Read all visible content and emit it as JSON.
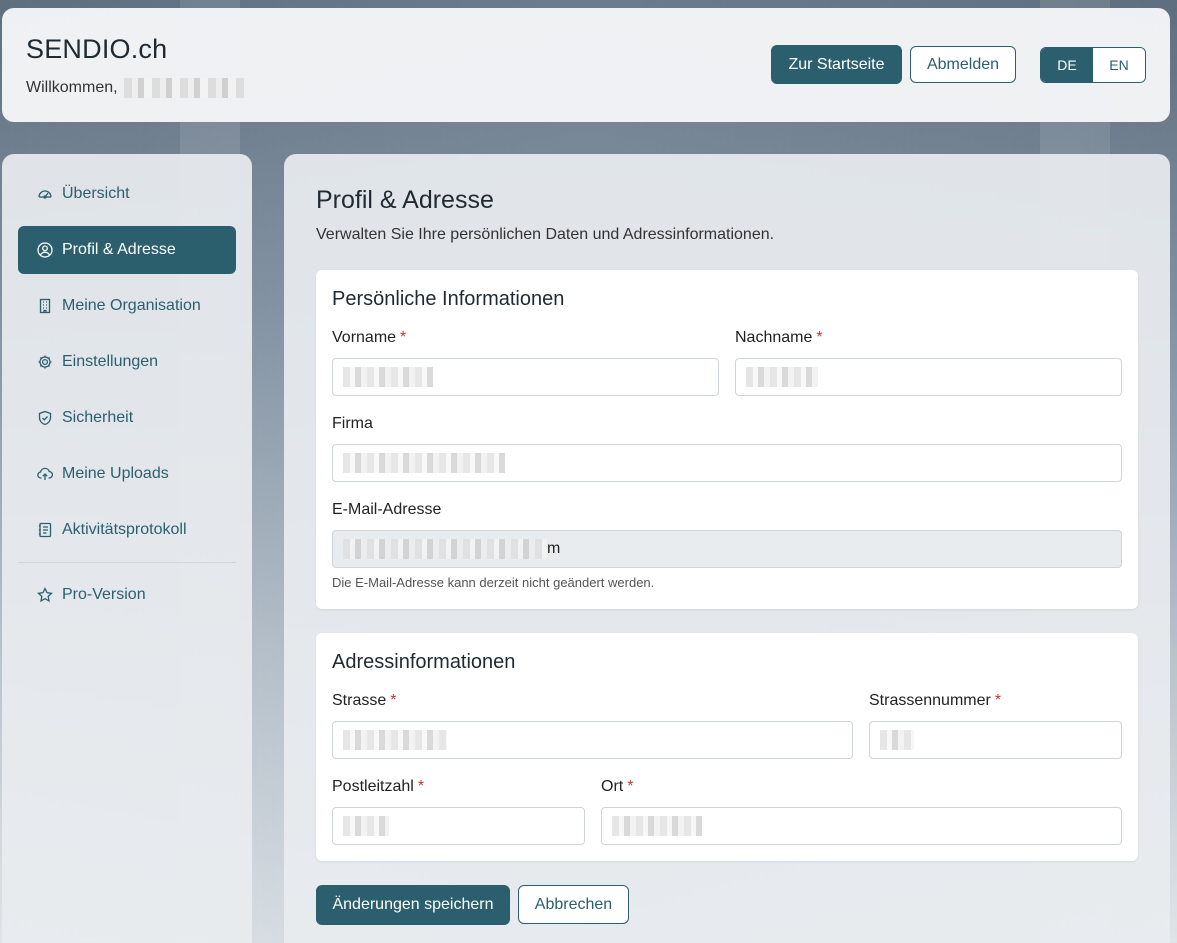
{
  "header": {
    "brand": "SENDIO.ch",
    "welcome": "Willkommen,",
    "home_button": "Zur Startseite",
    "logout_button": "Abmelden",
    "lang_de": "DE",
    "lang_en": "EN",
    "active_lang": "DE"
  },
  "sidebar": {
    "items": [
      {
        "label": "Übersicht",
        "icon": "gauge-icon"
      },
      {
        "label": "Profil & Adresse",
        "icon": "user-circle-icon",
        "active": true
      },
      {
        "label": "Meine Organisation",
        "icon": "building-icon"
      },
      {
        "label": "Einstellungen",
        "icon": "gear-icon"
      },
      {
        "label": "Sicherheit",
        "icon": "shield-icon"
      },
      {
        "label": "Meine Uploads",
        "icon": "cloud-upload-icon"
      },
      {
        "label": "Aktivitätsprotokoll",
        "icon": "journal-icon"
      },
      {
        "label": "Pro-Version",
        "icon": "star-icon"
      }
    ]
  },
  "main": {
    "title": "Profil & Adresse",
    "subtitle": "Verwalten Sie Ihre persönlichen Daten und Adressinformationen.",
    "personal": {
      "title": "Persönliche Informationen",
      "vorname_label": "Vorname",
      "nachname_label": "Nachname",
      "firma_label": "Firma",
      "email_label": "E-Mail-Adresse",
      "email_visible_suffix": "m",
      "email_hint": "Die E-Mail-Adresse kann derzeit nicht geändert werden."
    },
    "address": {
      "title": "Adressinformationen",
      "strasse_label": "Strasse",
      "strassennummer_label": "Strassennummer",
      "plz_label": "Postleitzahl",
      "ort_label": "Ort"
    },
    "required_marker": "*",
    "save_button": "Änderungen speichern",
    "cancel_button": "Abbrechen"
  },
  "colors": {
    "accent": "#2b5f6e",
    "required": "#c0392b"
  }
}
